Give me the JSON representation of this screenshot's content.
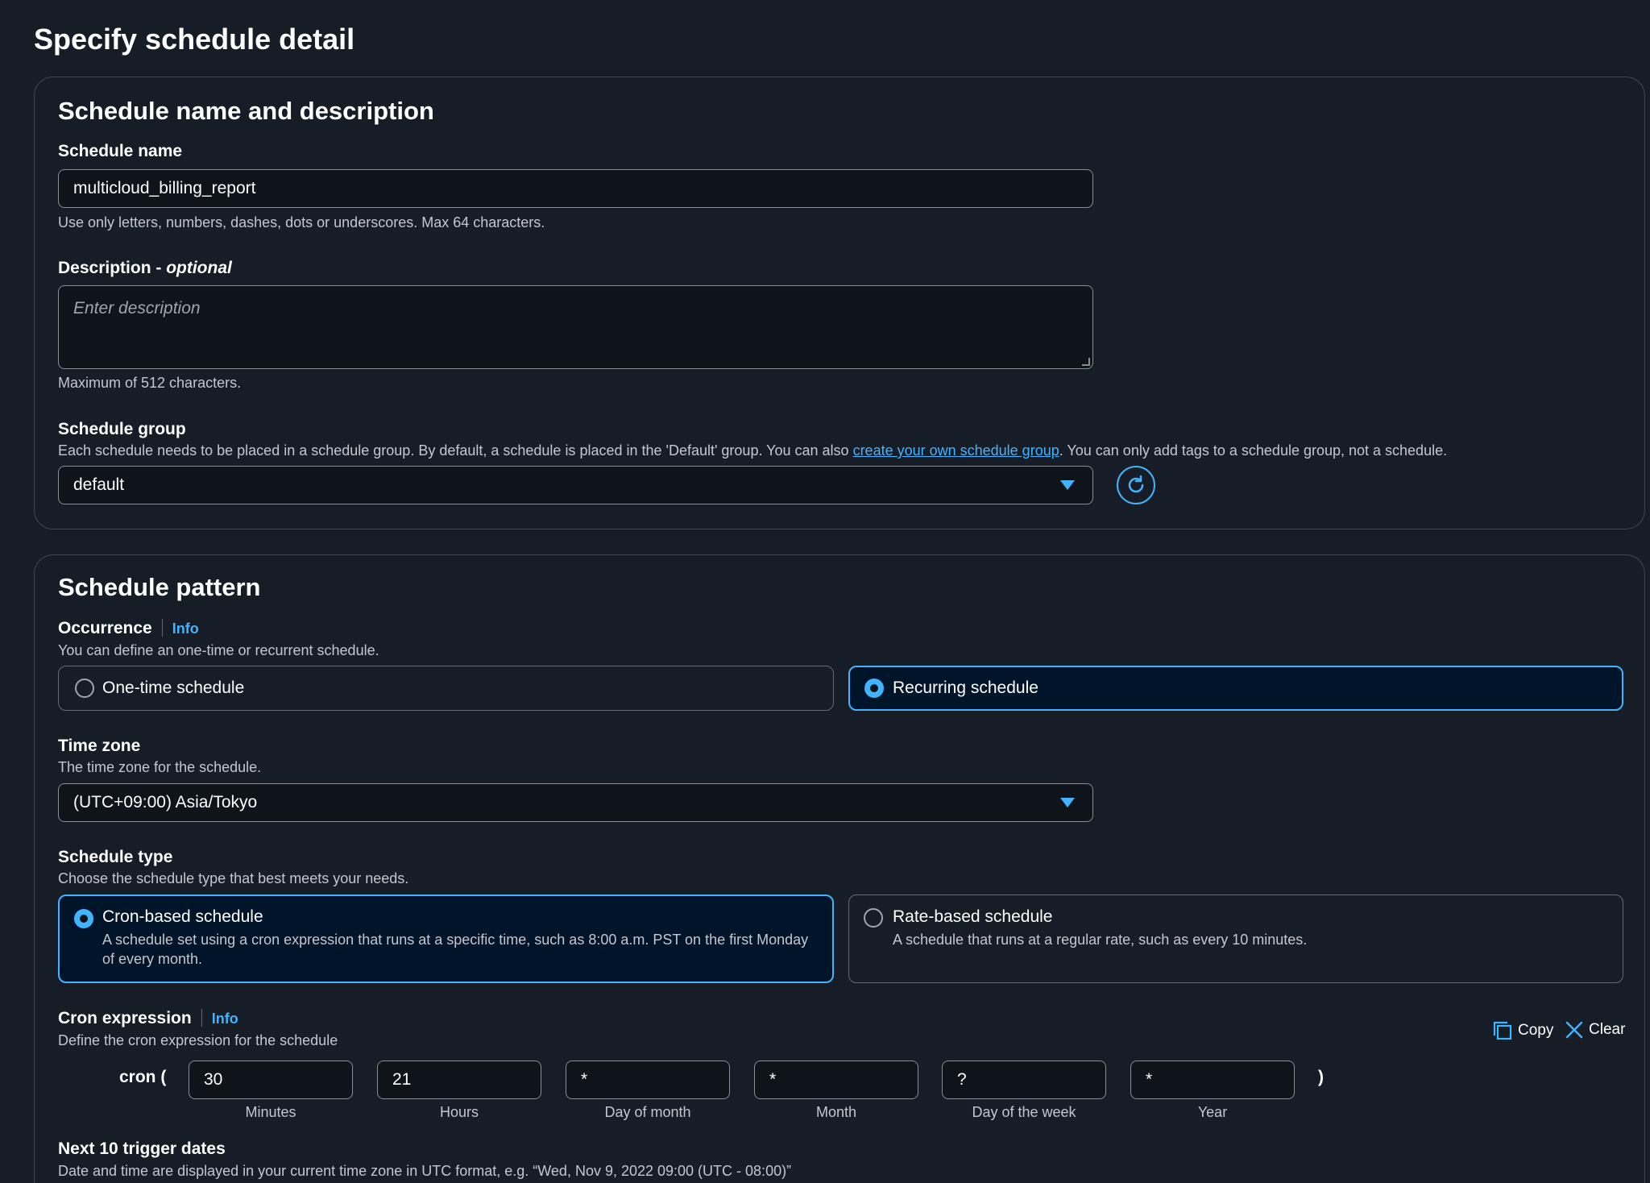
{
  "page_title": "Specify schedule detail",
  "section_name": {
    "heading": "Schedule name and description",
    "schedule_name": {
      "label": "Schedule name",
      "value": "multicloud_billing_report",
      "hint": "Use only letters, numbers, dashes, dots or underscores. Max 64 characters."
    },
    "description": {
      "label": "Description - ",
      "label_optional": "optional",
      "placeholder": "Enter description",
      "hint": "Maximum of 512 characters."
    },
    "schedule_group": {
      "label": "Schedule group",
      "desc_before": "Each schedule needs to be placed in a schedule group. By default, a schedule is placed in the 'Default' group. You can also ",
      "link": "create your own schedule group",
      "desc_after": ". You can only add tags to a schedule group, not a schedule.",
      "value": "default"
    }
  },
  "section_pattern": {
    "heading": "Schedule pattern",
    "occurrence": {
      "label": "Occurrence",
      "info": "Info",
      "desc": "You can define an one-time or recurrent schedule.",
      "options": [
        {
          "label": "One-time schedule",
          "selected": false
        },
        {
          "label": "Recurring schedule",
          "selected": true
        }
      ]
    },
    "time_zone": {
      "label": "Time zone",
      "desc": "The time zone for the schedule.",
      "value": "(UTC+09:00) Asia/Tokyo"
    },
    "schedule_type": {
      "label": "Schedule type",
      "desc": "Choose the schedule type that best meets your needs.",
      "options": [
        {
          "title": "Cron-based schedule",
          "desc": "A schedule set using a cron expression that runs at a specific time, such as 8:00 a.m. PST on the first Monday of every month.",
          "selected": true
        },
        {
          "title": "Rate-based schedule",
          "desc": "A schedule that runs at a regular rate, such as every 10 minutes.",
          "selected": false
        }
      ]
    },
    "cron": {
      "label": "Cron expression",
      "info": "Info",
      "desc": "Define the cron expression for the schedule",
      "copy": "Copy",
      "clear": "Clear",
      "prefix": "cron (",
      "suffix": ")",
      "fields": [
        {
          "value": "30",
          "caption": "Minutes"
        },
        {
          "value": "21",
          "caption": "Hours"
        },
        {
          "value": "*",
          "caption": "Day of month"
        },
        {
          "value": "*",
          "caption": "Month"
        },
        {
          "value": "?",
          "caption": "Day of the week"
        },
        {
          "value": "*",
          "caption": "Year"
        }
      ]
    },
    "next_dates": {
      "label": "Next 10 trigger dates",
      "desc": "Date and time are displayed in your current time zone in UTC format, e.g. “Wed, Nov 9, 2022 09:00 (UTC - 08:00)”"
    }
  },
  "colors": {
    "background": "#161d26",
    "accent": "#42b4ff",
    "input_bg": "#0f141a",
    "selected_bg": "#01152a"
  }
}
